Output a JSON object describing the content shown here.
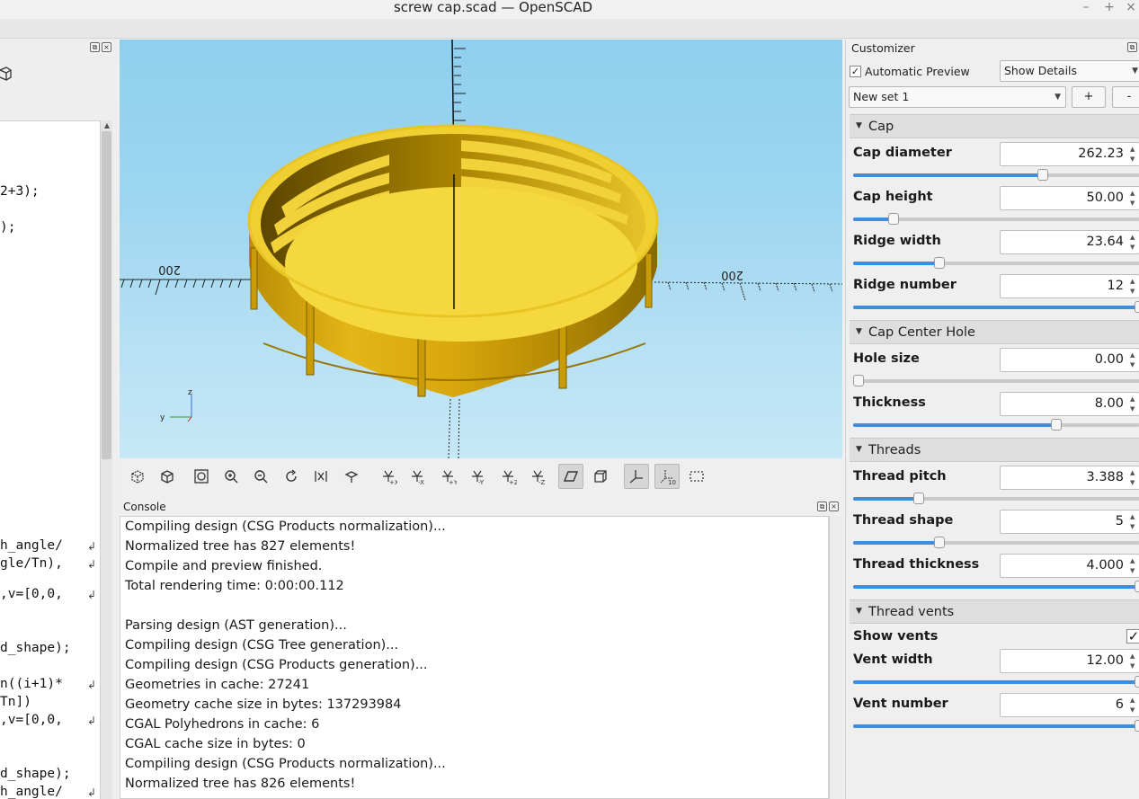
{
  "window": {
    "title": "screw cap.scad — OpenSCAD",
    "minimize": "–",
    "maximize": "+",
    "close": "×"
  },
  "editor": {
    "lines_top": [
      "2+3);",
      ");"
    ],
    "lines_bottom": [
      {
        "text": "h_angle/",
        "wrap": true
      },
      {
        "text": "gle/Tn),",
        "wrap": true
      },
      {
        "text": ",v=[0,0,",
        "wrap": true
      },
      {
        "text": "d_shape);",
        "wrap": false
      },
      {
        "text": "n((i+1)*",
        "wrap": true
      },
      {
        "text": "Tn])",
        "wrap": false
      },
      {
        "text": ",v=[0,0,",
        "wrap": true
      },
      {
        "text": "d_shape);",
        "wrap": false
      },
      {
        "text": "h_angle/",
        "wrap": true
      }
    ]
  },
  "viewport": {
    "axis_labels": {
      "left": "200",
      "right": "200",
      "gizmo_z": "z",
      "gizmo_y": "y"
    },
    "colors": {
      "model_top": "#f5d73e",
      "model_side": "#d4a50a",
      "model_dark": "#8a6a00",
      "sky_top": "#8fcfee",
      "sky_bottom": "#c6e7f6"
    }
  },
  "view_toolbar": {
    "buttons": [
      {
        "name": "preview-icon"
      },
      {
        "name": "render-icon"
      },
      {
        "name": "view-all-icon"
      },
      {
        "name": "zoom-in-icon"
      },
      {
        "name": "zoom-out-icon"
      },
      {
        "name": "reset-view-icon"
      },
      {
        "name": "view-ortho-mirror-icon"
      },
      {
        "name": "view-rotate-icon"
      },
      {
        "name": "view-right-icon",
        "label": "+X"
      },
      {
        "name": "view-left-icon",
        "label": "-X"
      },
      {
        "name": "view-back-icon",
        "label": "+Y"
      },
      {
        "name": "view-front-icon",
        "label": "-Y"
      },
      {
        "name": "view-top-icon",
        "label": "+Z"
      },
      {
        "name": "view-bottom-icon",
        "label": "-Z"
      },
      {
        "name": "perspective-icon",
        "active": true
      },
      {
        "name": "orthogonal-icon"
      },
      {
        "name": "show-axes-icon",
        "active": true
      },
      {
        "name": "show-scale-icon",
        "active": true,
        "label": "10"
      },
      {
        "name": "show-edges-icon"
      }
    ]
  },
  "console": {
    "title": "Console",
    "lines": [
      "Compiling design (CSG Products normalization)...",
      "Normalized tree has 827 elements!",
      "Compile and preview finished.",
      "Total rendering time: 0:00:00.112",
      "",
      "Parsing design (AST generation)...",
      "Compiling design (CSG Tree generation)...",
      "Compiling design (CSG Products generation)...",
      "Geometries in cache: 27241",
      "Geometry cache size in bytes: 137293984",
      "CGAL Polyhedrons in cache: 6",
      "CGAL cache size in bytes: 0",
      "Compiling design (CSG Products normalization)...",
      "Normalized tree has 826 elements!"
    ]
  },
  "customizer": {
    "title": "Customizer",
    "auto_preview_label": "Automatic Preview",
    "auto_preview_checked": "✓",
    "details_select": "Show Details",
    "preset_select": "New set 1",
    "add_label": "+",
    "remove_label": "-",
    "sections": [
      {
        "title": "Cap",
        "params": [
          {
            "name": "Cap diameter",
            "value": "262.23",
            "level": 0.66
          },
          {
            "name": "Cap height",
            "value": "50.00",
            "level": 0.14
          },
          {
            "name": "Ridge width",
            "value": "23.64",
            "level": 0.3
          },
          {
            "name": "Ridge number",
            "value": "12",
            "level": 1.0
          }
        ]
      },
      {
        "title": "Cap Center Hole",
        "params": [
          {
            "name": "Hole size",
            "value": "0.00",
            "level": 0.02
          },
          {
            "name": "Thickness",
            "value": "8.00",
            "level": 0.71
          }
        ]
      },
      {
        "title": "Threads",
        "params": [
          {
            "name": "Thread pitch",
            "value": "3.388",
            "level": 0.23
          },
          {
            "name": "Thread shape",
            "value": "5",
            "level": 0.3
          },
          {
            "name": "Thread thickness",
            "value": "4.000",
            "level": 1.0
          }
        ]
      },
      {
        "title": "Thread vents",
        "params": [
          {
            "name": "Show vents",
            "checkbox": "✓"
          },
          {
            "name": "Vent width",
            "value": "12.00",
            "level": 1.0
          },
          {
            "name": "Vent number",
            "value": "6",
            "level": 1.0
          }
        ]
      }
    ]
  }
}
